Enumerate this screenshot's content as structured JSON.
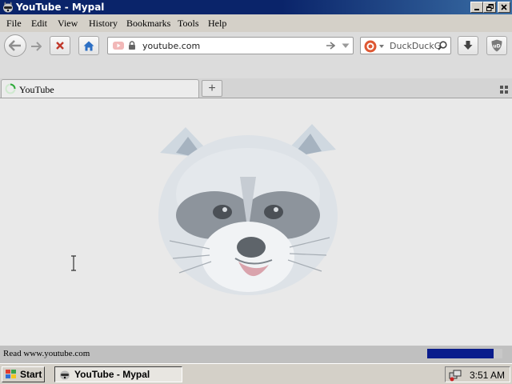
{
  "window": {
    "title": "YouTube - Mypal",
    "icon": "raccoon-app-icon",
    "controls": [
      "minimize-icon",
      "restore-icon",
      "close-icon"
    ]
  },
  "menubar": {
    "items": [
      "File",
      "Edit",
      "View",
      "History",
      "Bookmarks",
      "Tools",
      "Help"
    ]
  },
  "toolbar": {
    "buttons": [
      "back-icon",
      "forward-icon",
      "stop-icon",
      "home-icon",
      "download-icon",
      "ublock-icon"
    ],
    "url": "youtube.com",
    "search_placeholder": "DuckDuckG",
    "ublock_label": "uD"
  },
  "tabs": {
    "items": [
      {
        "title": "YouTube",
        "loading": true
      }
    ],
    "new_tab_label": "+"
  },
  "content": {
    "image": "raccoon-face"
  },
  "statusbar": {
    "text": "Read www.youtube.com",
    "progress_fraction": 0.88
  },
  "taskbar": {
    "start_label": "Start",
    "task_label": "YouTube - Mypal",
    "clock": "3:51 AM"
  },
  "colors": {
    "titlebar": "#0a246a",
    "progress": "#0a1c8c",
    "stop_red": "#c0392b",
    "home_blue": "#2c6fc4"
  }
}
